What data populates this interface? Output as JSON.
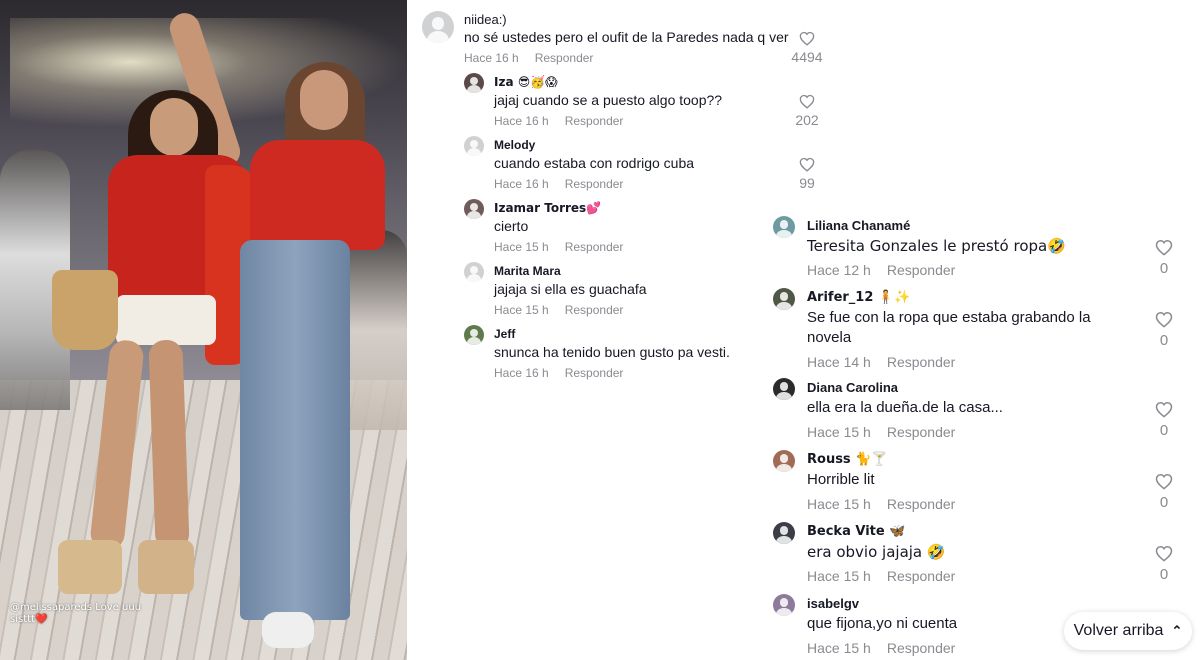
{
  "photo": {
    "caption": "@melissapareds Love uuu sisttt❤️"
  },
  "comments": [
    {
      "user": "niidea:)",
      "text": "no sé ustedes pero el oufit de la Paredes nada q ver",
      "time": "Hace 16 h",
      "reply": "Responder",
      "likes": "4494",
      "avatar_color": "#d0d1d3"
    },
    {
      "user": "Iza 😎🥳😱",
      "text": "jajaj cuando se a puesto algo toop??",
      "time": "Hace 16 h",
      "reply": "Responder",
      "likes": "202",
      "avatar_color": "#5a4a48"
    },
    {
      "user": "Melody",
      "text": "cuando estaba con rodrigo cuba",
      "time": "Hace 16 h",
      "reply": "Responder",
      "likes": "99",
      "avatar_color": "#d0d1d3"
    },
    {
      "user": "Izamar Torres💕",
      "text": "cierto",
      "time": "Hace 15 h",
      "reply": "Responder",
      "likes": "",
      "avatar_color": "#6e5c5a"
    },
    {
      "user": "Marita Mara",
      "text": "jajaja si ella es guachafa",
      "time": "Hace 15 h",
      "reply": "Responder",
      "likes": "",
      "avatar_color": "#d0d1d3"
    },
    {
      "user": "Jeff",
      "text": "snunca ha tenido buen gusto pa vesti.",
      "time": "Hace 16 h",
      "reply": "Responder",
      "likes": "",
      "avatar_color": "#5f7a4c"
    },
    {
      "user": "Liliana Chanamé",
      "text": "Teresita Gonzales le prestó ropa🤣",
      "time": "Hace 12 h",
      "reply": "Responder",
      "likes": "0",
      "avatar_color": "#6f9aa1"
    },
    {
      "user": "Arifer_12 🧍✨",
      "text": "Se fue con la ropa que estaba grabando la",
      "text2": "novela",
      "time": "Hace 14 h",
      "reply": "Responder",
      "likes": "0",
      "avatar_color": "#4f5747"
    },
    {
      "user": "Diana Carolina",
      "text": "ella era la dueña.de la casa...",
      "time": "Hace 15 h",
      "reply": "Responder",
      "likes": "0",
      "avatar_color": "#2b2b2b"
    },
    {
      "user": "Rouss 🐈🍸",
      "text": "Horrible lit",
      "time": "Hace 15 h",
      "reply": "Responder",
      "likes": "0",
      "avatar_color": "#a26b58"
    },
    {
      "user": "Becka Vite 🦋",
      "text": "era obvio jajaja 🤣",
      "time": "Hace 15 h",
      "reply": "Responder",
      "likes": "0",
      "avatar_color": "#3b3e44"
    },
    {
      "user": "isabelgv",
      "text": "que fijona,yo ni cuenta",
      "time": "Hace 15 h",
      "reply": "Responder",
      "likes": "",
      "avatar_color": "#8d7b9a"
    }
  ],
  "back_to_top": {
    "label": "Volver arriba",
    "icon": "double-chevron-up-icon"
  }
}
